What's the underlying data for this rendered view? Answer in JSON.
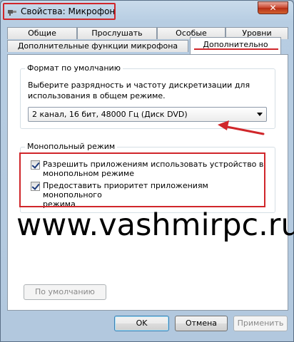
{
  "window": {
    "title": "Свойства: Микрофон",
    "close_label": "✕"
  },
  "tabs": {
    "row1": [
      "Общие",
      "Прослушать",
      "Особые",
      "Уровни"
    ],
    "row2": [
      "Дополнительные функции микрофона",
      "Дополнительно"
    ],
    "active": "Дополнительно"
  },
  "default_format": {
    "title": "Формат по умолчанию",
    "description": [
      "Выберите разрядность и частоту дискретизации для",
      "использования в общем режиме."
    ],
    "selected": "2 канал, 16 бит, 48000 Гц (Диск DVD)"
  },
  "exclusive_mode": {
    "title": "Монопольный режим",
    "options": [
      {
        "lines": [
          "Разрешить приложениям использовать устройство в",
          "монопольном режиме"
        ],
        "checked": true
      },
      {
        "lines": [
          "Предоставить приоритет приложениям монопольного",
          "режима"
        ],
        "checked": true
      }
    ]
  },
  "watermark": "www.vashmirpc.ru",
  "buttons": {
    "restore_default": "По умолчанию",
    "ok": "OK",
    "cancel": "Отмена",
    "apply": "Применить"
  },
  "annotation_color": "#d0262a"
}
